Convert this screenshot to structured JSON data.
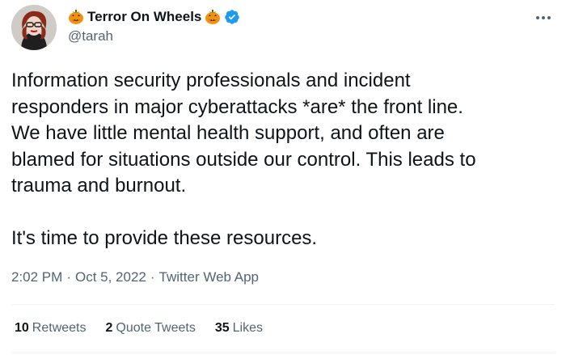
{
  "author": {
    "display_name": "Terror On Wheels",
    "handle": "@tarah",
    "verified": true,
    "name_emoji": "jack-o-lantern-icon"
  },
  "tweet": {
    "text": "Information security professionals and incident\nresponders in major cyberattacks *are* the front line.\nWe have little mental health support, and often are\nblamed for situations outside our control. This leads to\ntrauma and burnout.\n\nIt's time to provide these resources.",
    "time": "2:02 PM",
    "date": "Oct 5, 2022",
    "source": "Twitter Web App",
    "separator": "·"
  },
  "stats": {
    "retweets_count": "10",
    "retweets_label": "Retweets",
    "quotes_count": "2",
    "quotes_label": "Quote Tweets",
    "likes_count": "35",
    "likes_label": "Likes"
  },
  "colors": {
    "text": "#0f1419",
    "secondary": "#536471",
    "verified": "#1d9bf0",
    "pumpkin": "#f4900c",
    "divider": "#eff3f4"
  }
}
